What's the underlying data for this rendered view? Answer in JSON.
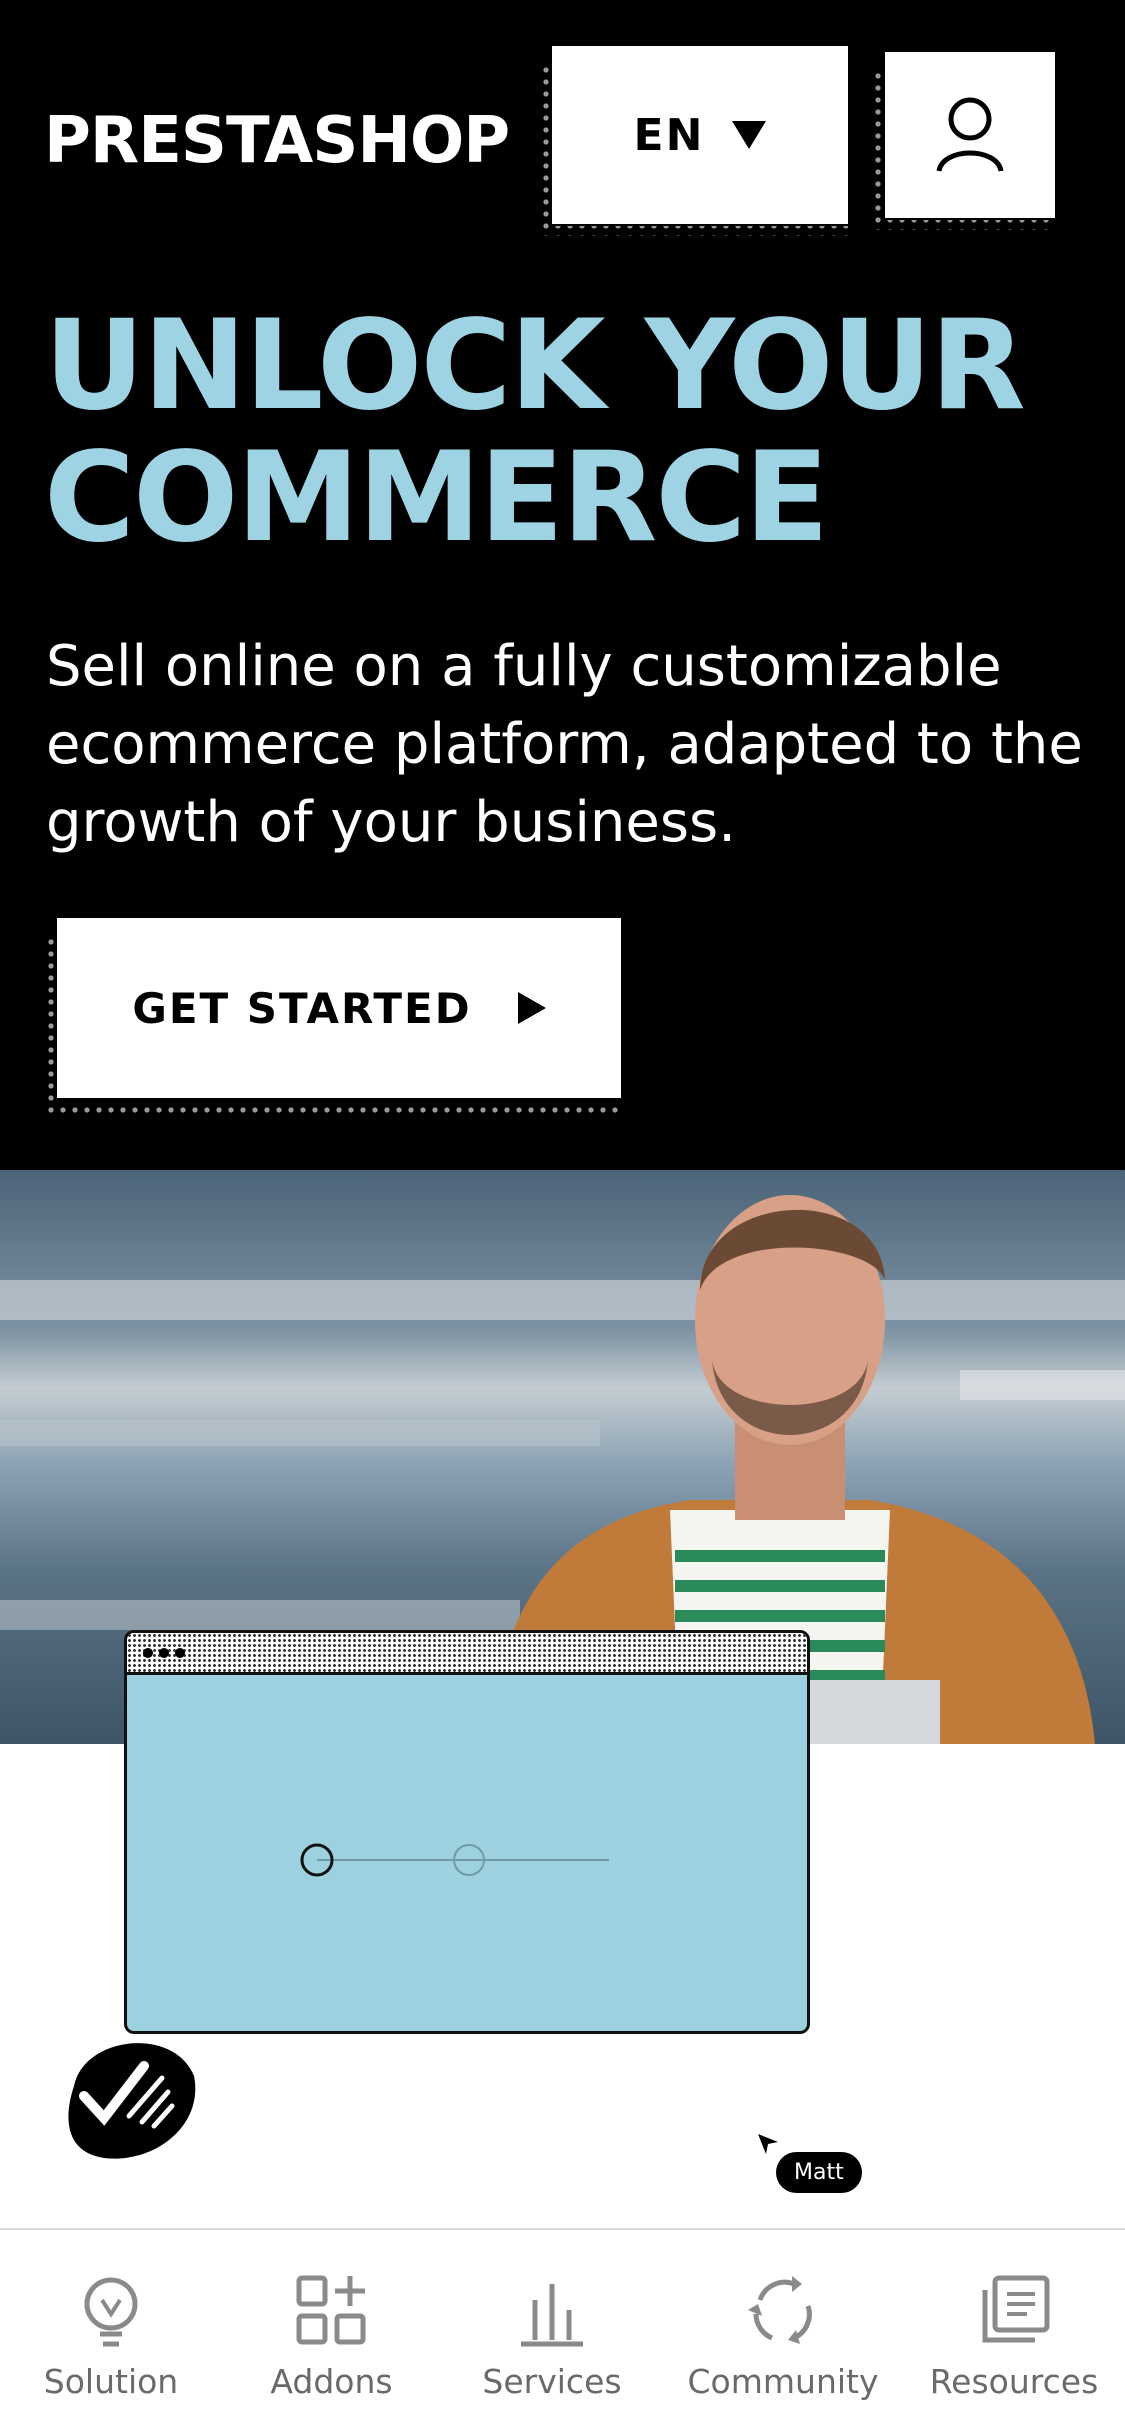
{
  "header": {
    "logo": "PRESTASHOP",
    "language": "EN",
    "account_icon": "user-icon"
  },
  "hero": {
    "title_line1": "UNLOCK YOUR",
    "title_line2": "COMMERCE",
    "subtitle": "Sell online on a fully customizable ecommerce platform, adapted to the growth of your business.",
    "cta_label": "GET STARTED"
  },
  "illustration": {
    "cursor_label": "Matt"
  },
  "bottom_nav": {
    "items": [
      {
        "label": "Solution",
        "icon": "lightbulb-icon"
      },
      {
        "label": "Addons",
        "icon": "addons-grid-icon"
      },
      {
        "label": "Services",
        "icon": "services-chart-icon"
      },
      {
        "label": "Community",
        "icon": "community-cycle-icon"
      },
      {
        "label": "Resources",
        "icon": "resources-docs-icon"
      }
    ]
  },
  "colors": {
    "background": "#000000",
    "accent": "#9dd3e3",
    "text_on_dark": "#ffffff",
    "nav_text": "#6a6a6a"
  }
}
